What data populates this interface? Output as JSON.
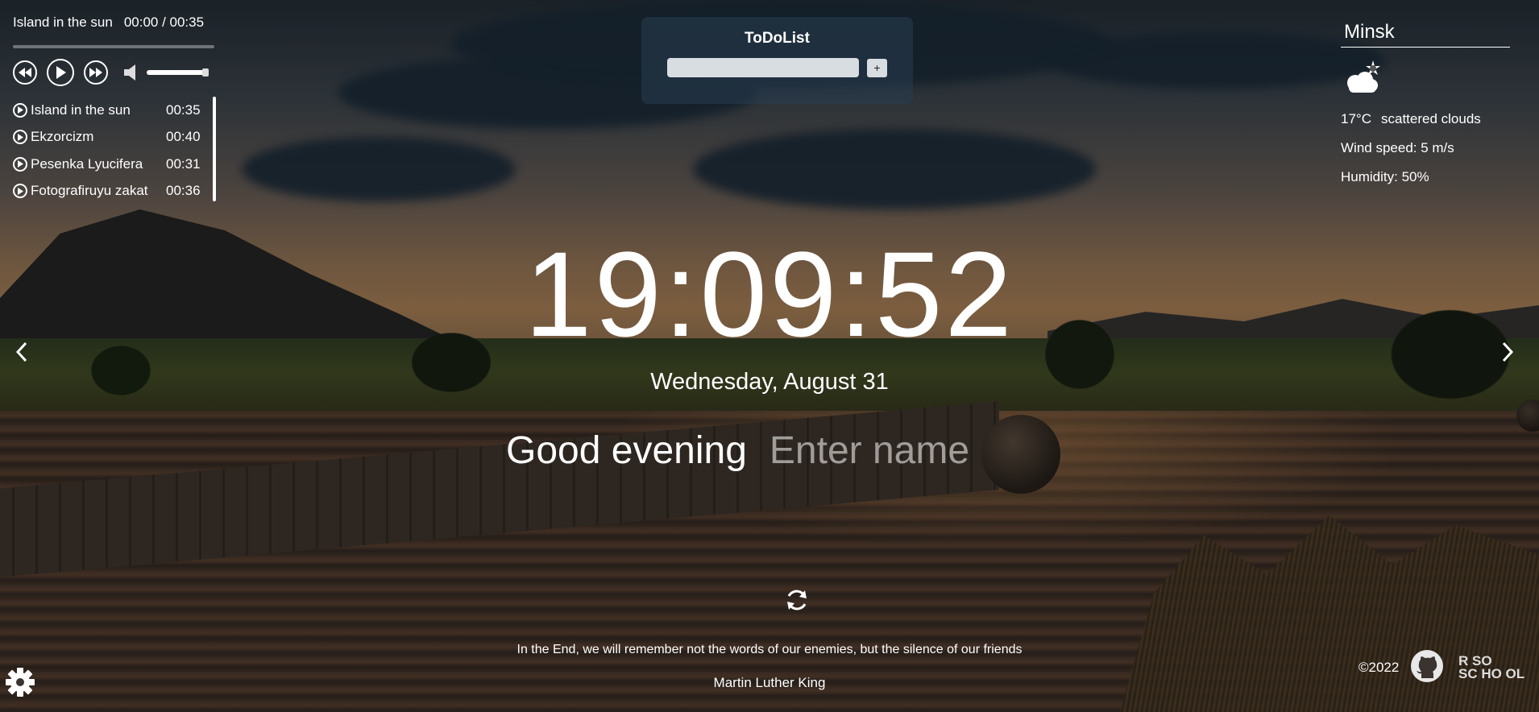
{
  "player": {
    "current_title": "Island in the sun",
    "current_time": "00:00 / 00:35",
    "playlist": [
      {
        "title": "Island in the sun",
        "duration": "00:35"
      },
      {
        "title": "Ekzorcizm",
        "duration": "00:40"
      },
      {
        "title": "Pesenka Lyucifera",
        "duration": "00:31"
      },
      {
        "title": "Fotografiruyu zakat",
        "duration": "00:36"
      }
    ],
    "volume": 1.0,
    "progress": 0.0
  },
  "todo": {
    "title": "ToDoList",
    "input_value": "",
    "add_label": "+"
  },
  "weather": {
    "city": "Minsk",
    "icon": "partly-cloudy-night-icon",
    "temperature": "17°C",
    "description": "scattered clouds",
    "wind": "Wind speed: 5 m/s",
    "humidity": "Humidity: 50%"
  },
  "clock": {
    "time": "19:09:52",
    "date": "Wednesday, August 31"
  },
  "greeting": {
    "text": "Good evening",
    "name_placeholder": "Enter name"
  },
  "quote": {
    "text": "In the End, we will remember not the words of our enemies, but the silence of our friends",
    "author": "Martin Luther King"
  },
  "footer": {
    "copyright": "©2022",
    "school_logo_line1": "R    SO",
    "school_logo_line2": "SC HO OL"
  },
  "colors": {
    "overlay": "#000000",
    "todo_panel": "#283c50",
    "text": "#ffffff"
  }
}
